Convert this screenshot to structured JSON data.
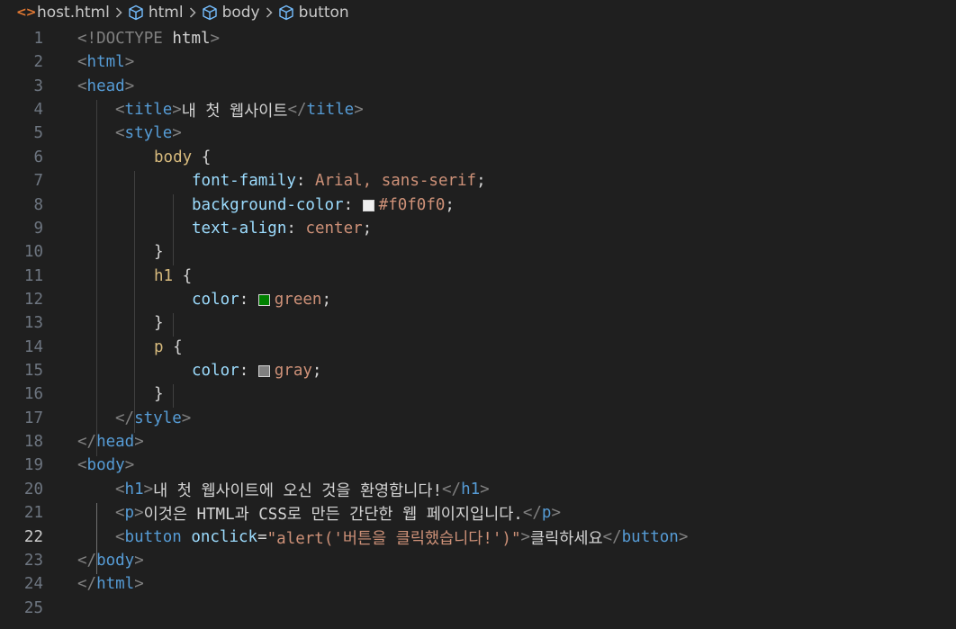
{
  "breadcrumb": {
    "file": "host.html",
    "items": [
      "html",
      "body",
      "button"
    ]
  },
  "colors": {
    "f0f0f0": "#f0f0f0",
    "green": "#008000",
    "gray": "#808080"
  },
  "lines": {
    "n": [
      "1",
      "2",
      "3",
      "4",
      "5",
      "6",
      "7",
      "8",
      "9",
      "10",
      "11",
      "12",
      "13",
      "14",
      "15",
      "16",
      "17",
      "18",
      "19",
      "20",
      "21",
      "22",
      "23",
      "24",
      "25"
    ],
    "doctype": "!DOCTYPE",
    "doctype_html": "html",
    "html": "html",
    "head": "head",
    "title": "title",
    "title_text": "내 첫 웹사이트",
    "style": "style",
    "body_sel": "body",
    "ff_prop": "font-family",
    "ff_val": "Arial, sans-serif",
    "bg_prop": "background-color",
    "bg_val": "#f0f0f0",
    "ta_prop": "text-align",
    "ta_val": "center",
    "h1_sel": "h1",
    "color_prop": "color",
    "green_val": "green",
    "p_sel": "p",
    "gray_val": "gray",
    "body": "body",
    "h1": "h1",
    "h1_text": "내 첫 웹사이트에 오신 것을 환영합니다!",
    "p": "p",
    "p_text": "이것은 HTML과 CSS로 만든 간단한 웹 페이지입니다.",
    "button": "button",
    "onclick_attr": "onclick",
    "onclick_val": "\"alert('버튼을 클릭했습니다!')\"",
    "button_text": "클릭하세요"
  },
  "active_line": "22"
}
